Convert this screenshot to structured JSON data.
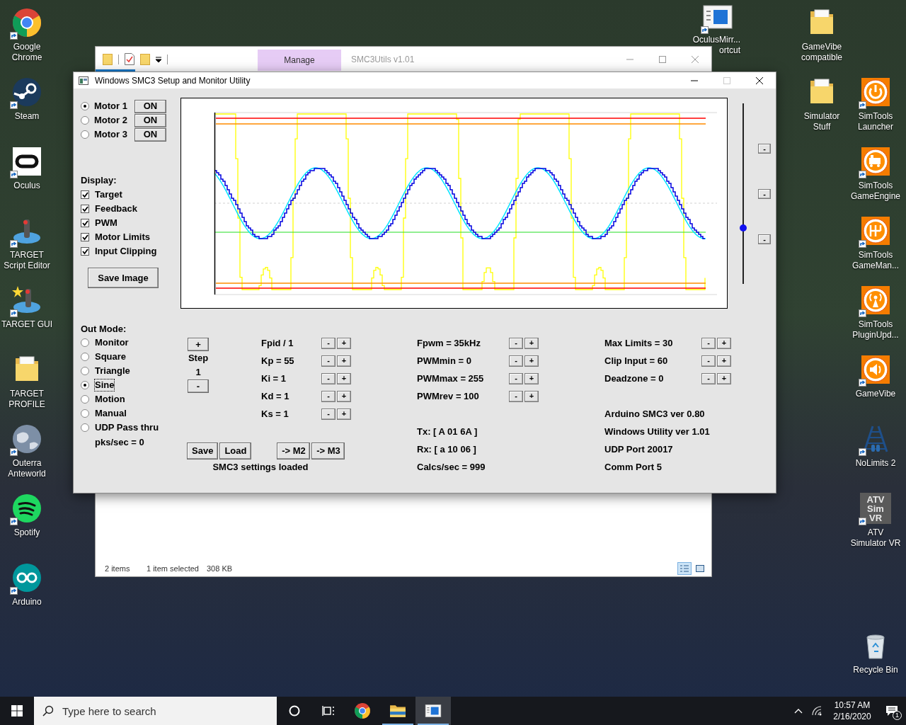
{
  "desktop_icons": [
    {
      "kind": "browser",
      "lines": [
        "Google",
        "Chrome"
      ],
      "shortcut": true
    },
    {
      "kind": "game-client",
      "lines": [
        "Steam"
      ],
      "shortcut": true
    },
    {
      "kind": "headset",
      "lines": [
        "Oculus"
      ],
      "shortcut": true
    },
    {
      "kind": "joystick",
      "lines": [
        "TARGET",
        "Script Editor"
      ],
      "shortcut": true
    },
    {
      "kind": "joystick-star",
      "lines": [
        "TARGET GUI"
      ],
      "shortcut": true
    },
    {
      "kind": "folder",
      "lines": [
        "TARGET",
        "PROFILE"
      ],
      "shortcut": false
    },
    {
      "kind": "globe",
      "lines": [
        "Outerra",
        "Anteworld"
      ],
      "shortcut": true
    },
    {
      "kind": "music-app",
      "lines": [
        "Spotify"
      ],
      "shortcut": true
    },
    {
      "kind": "infinity",
      "lines": [
        "Arduino"
      ],
      "shortcut": true
    },
    {
      "kind": "window",
      "lines": [
        "OculusMirr...",
        "ortcut"
      ],
      "shortcut": true
    },
    {
      "kind": "folder",
      "lines": [
        "GameVibe",
        "compatible"
      ],
      "shortcut": false
    },
    {
      "kind": "folder",
      "lines": [
        "Simulator",
        "Stuff"
      ],
      "shortcut": false
    },
    {
      "kind": "power",
      "lines": [
        "SimTools",
        "Launcher"
      ],
      "shortcut": true
    },
    {
      "kind": "locomotive",
      "lines": [
        "SimTools",
        "GameEngine"
      ],
      "shortcut": true
    },
    {
      "kind": "gear-shift",
      "lines": [
        "SimTools",
        "GameMan..."
      ],
      "shortcut": true
    },
    {
      "kind": "antenna",
      "lines": [
        "SimTools",
        "PluginUpd..."
      ],
      "shortcut": true
    },
    {
      "kind": "speaker",
      "lines": [
        "GameVibe"
      ],
      "shortcut": true
    },
    {
      "kind": "roller-coaster",
      "lines": [
        "NoLimits 2"
      ],
      "shortcut": true
    },
    {
      "kind": "text-tile",
      "tile_text": [
        "ATV",
        "Sim",
        "VR"
      ],
      "lines": [
        "ATV",
        "Simulator VR"
      ],
      "shortcut": true
    },
    {
      "kind": "recycle-bin",
      "lines": [
        "Recycle Bin"
      ],
      "shortcut": false
    }
  ],
  "explorer_window": {
    "ribbon_tab": "Manage",
    "title": "SMC3Utils v1.01",
    "status": [
      "2 items",
      "1 item selected",
      "308 KB"
    ]
  },
  "app_window": {
    "title": "Windows SMC3 Setup and Monitor Utility",
    "motors": [
      {
        "label": "Motor 1",
        "selected": true,
        "toggle": "ON"
      },
      {
        "label": "Motor 2",
        "selected": false,
        "toggle": "ON"
      },
      {
        "label": "Motor 3",
        "selected": false,
        "toggle": "ON"
      }
    ],
    "display_label": "Display:",
    "display_options": [
      {
        "label": "Target",
        "checked": true
      },
      {
        "label": "Feedback",
        "checked": true
      },
      {
        "label": "PWM",
        "checked": true
      },
      {
        "label": "Motor Limits",
        "checked": true
      },
      {
        "label": "Input Clipping",
        "checked": true
      }
    ],
    "save_image": "Save Image",
    "slider": {
      "level": 0.31
    },
    "side_buttons": [
      "-",
      "-",
      "-"
    ],
    "out_mode_label": "Out Mode:",
    "out_modes": [
      {
        "label": "Monitor",
        "selected": false,
        "focused": false
      },
      {
        "label": "Square",
        "selected": false,
        "focused": false
      },
      {
        "label": "Triangle",
        "selected": false,
        "focused": false
      },
      {
        "label": "Sine",
        "selected": true,
        "focused": true
      },
      {
        "label": "Motion",
        "selected": false,
        "focused": false
      },
      {
        "label": "Manual",
        "selected": false,
        "focused": false
      },
      {
        "label": "UDP Pass thru",
        "selected": false,
        "focused": false
      }
    ],
    "packets": "pks/sec = 0",
    "step": {
      "plus": "+",
      "label": "Step",
      "value": "1",
      "minus": "-"
    },
    "pid_params": [
      {
        "label": "Fpid / 1",
        "buttons": [
          "-",
          "+"
        ]
      },
      {
        "label": "Kp = 55",
        "buttons": [
          "-",
          "+"
        ]
      },
      {
        "label": "Ki = 1",
        "buttons": [
          "-",
          "+"
        ]
      },
      {
        "label": "Kd = 1",
        "buttons": [
          "-",
          "+"
        ]
      },
      {
        "label": "Ks = 1",
        "buttons": [
          "-",
          "+"
        ]
      }
    ],
    "file_buttons": [
      "Save",
      "Load"
    ],
    "copy_buttons": [
      "-> M2",
      "-> M3"
    ],
    "message": "SMC3 settings loaded",
    "pwm_params": [
      {
        "label": "Fpwm = 35kHz",
        "buttons": [
          "-",
          "+"
        ]
      },
      {
        "label": "PWMmin = 0",
        "buttons": [
          "-",
          "+"
        ]
      },
      {
        "label": "PWMmax = 255",
        "buttons": [
          "-",
          "+"
        ]
      },
      {
        "label": "PWMrev = 100",
        "buttons": [
          "-",
          "+"
        ]
      }
    ],
    "io_lines": [
      "Tx: [ A 01 6A ]",
      "Rx: [ a 10 06 ]",
      "Calcs/sec = 999"
    ],
    "limit_params": [
      {
        "label": "Max Limits = 30",
        "buttons": [
          "-",
          "+"
        ]
      },
      {
        "label": "Clip Input = 60",
        "buttons": [
          "-",
          "+"
        ]
      },
      {
        "label": "Deadzone = 0",
        "buttons": [
          "-",
          "+"
        ]
      }
    ],
    "info_lines": [
      "Arduino SMC3 ver 0.80",
      "Windows Utility ver 1.01",
      "UDP Port 20017",
      "Comm Port 5"
    ]
  },
  "taskbar": {
    "search_placeholder": "Type here to search",
    "apps": [
      {
        "kind": "browser",
        "open": false,
        "selected": false
      },
      {
        "kind": "folder",
        "open": true,
        "selected": false
      },
      {
        "kind": "window",
        "open": true,
        "selected": true
      }
    ],
    "time": "10:57 AM",
    "date": "2/16/2020",
    "notification_count": "1"
  }
}
